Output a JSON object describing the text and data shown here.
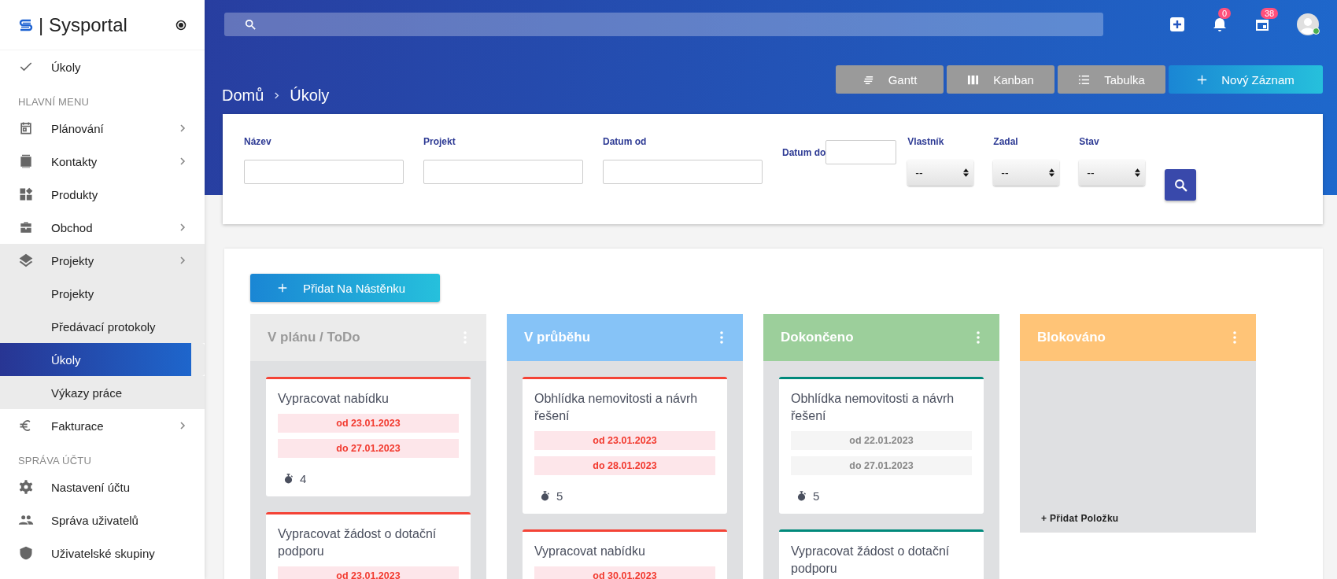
{
  "sidebar": {
    "logo": "| Sysportal",
    "items": [
      {
        "kind": "shortcut",
        "label": "Úkoly"
      },
      {
        "kind": "heading",
        "label": "HLAVNÍ MENU"
      },
      {
        "kind": "menu",
        "label": "Plánování",
        "expanded": false
      },
      {
        "kind": "menu",
        "label": "Kontakty",
        "expanded": false
      },
      {
        "kind": "menu",
        "label": "Produkty"
      },
      {
        "kind": "menu",
        "label": "Obchod",
        "expanded": false
      },
      {
        "kind": "menu",
        "label": "Projekty",
        "expanded": true,
        "children": [
          {
            "label": "Projekty",
            "selected": false
          },
          {
            "label": "Předávací protokoly",
            "selected": false
          },
          {
            "label": "Úkoly",
            "selected": true
          },
          {
            "label": "Výkazy práce",
            "selected": false
          }
        ]
      },
      {
        "kind": "menu",
        "label": "Fakturace",
        "expanded": false
      },
      {
        "kind": "heading",
        "label": "SPRÁVA ÚČTU"
      },
      {
        "kind": "menu",
        "label": "Nastavení účtu"
      },
      {
        "kind": "menu",
        "label": "Správa uživatelů"
      },
      {
        "kind": "menu",
        "label": "Uživatelské skupiny"
      }
    ]
  },
  "topbar": {
    "notifications": "0",
    "calendar": "38"
  },
  "breadcrumb": [
    "Domů",
    "Úkoly"
  ],
  "views": [
    {
      "kind": "view",
      "label": "Gantt"
    },
    {
      "kind": "view",
      "label": "Kanban"
    },
    {
      "kind": "view",
      "label": "Tabulka"
    },
    {
      "kind": "primary",
      "label": "Nový Záznam"
    }
  ],
  "filters": [
    {
      "kind": "text",
      "label": "Název"
    },
    {
      "kind": "text",
      "label": "Projekt"
    },
    {
      "kind": "text",
      "label": "Datum od"
    },
    {
      "kind": "date",
      "label": "Datum do"
    },
    {
      "kind": "select",
      "label": "Vlastník",
      "value": "--"
    },
    {
      "kind": "select",
      "label": "Zadal",
      "value": "--"
    },
    {
      "kind": "select",
      "label": "Stav",
      "value": "--"
    }
  ],
  "board": {
    "add_button": "Přidat Na Nástěnku",
    "columns": [
      {
        "title": "V plánu / ToDo",
        "color": "#ebebeb",
        "cards": [
          {
            "title": "Vypracovat nabídku",
            "color": "#f44336",
            "overdue": true,
            "from": "od 23.01.2023",
            "to": "do 27.01.2023",
            "count": "4"
          },
          {
            "title": "Vypracovat žádost o dotační podporu",
            "color": "#f44336",
            "overdue": true,
            "from": "od 23.01.2023"
          }
        ]
      },
      {
        "title": "V průběhu",
        "color": "#86c3f7",
        "cards": [
          {
            "title": "Obhlídka nemovitosti a návrh řešení",
            "color": "#f44336",
            "overdue": true,
            "from": "od 23.01.2023",
            "to": "do 28.01.2023",
            "count": "5"
          },
          {
            "title": "Vypracovat nabídku",
            "color": "#f44336",
            "overdue": true,
            "from": "od 30.01.2023"
          }
        ]
      },
      {
        "title": "Dokončeno",
        "color": "#9ccf9b",
        "cards": [
          {
            "title": "Obhlídka nemovitosti a návrh řešení",
            "color": "#00897b",
            "overdue": false,
            "from": "od 22.01.2023",
            "to": "do 27.01.2023",
            "count": "5"
          },
          {
            "title": "Vypracovat žádost o dotační podporu",
            "color": "#00897b"
          }
        ]
      },
      {
        "title": "Blokováno",
        "color": "#ffc477",
        "add_label": "+ Přidat Položku"
      }
    ]
  }
}
